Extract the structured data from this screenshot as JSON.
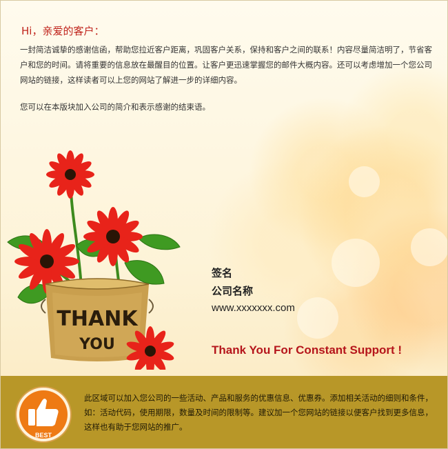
{
  "greeting": "Hi，亲爱的客户：",
  "intro": "一封简洁诚挚的感谢信函，帮助您拉近客户距离，巩固客户关系，保持和客户之间的联系！内容尽量简洁明了，节省客户和您的时间。请将重要的信息放在最醒目的位置。让客户更迅速掌握您的邮件大概内容。还可以考虑增加一个您公司网站的链接，这样读者可以上您的网站了解进一步的详细内容。",
  "note": "您可以在本版块加入公司的简介和表示感谢的结束语。",
  "pot": {
    "line1": "THANK",
    "line2": "YOU"
  },
  "signature": {
    "name": "签名",
    "company": "公司名称",
    "website": "www.xxxxxxx.com"
  },
  "thanks": "Thank You For  Constant Support !",
  "badge": {
    "label": "BEST",
    "icon": "thumbs-up-icon"
  },
  "footer_text": "此区域可以加入您公司的一些活动、产品和服务的优惠信息、优惠券。添加相关活动的细则和条件，如：活动代码，使用期限，数量及时间的限制等。建议加一个您网站的链接以便客户找到更多信息，这样也有助于您网站的推广。",
  "colors": {
    "accent_red": "#c0241c",
    "footer_bg": "#b89728",
    "badge_orange": "#ee7a14"
  }
}
